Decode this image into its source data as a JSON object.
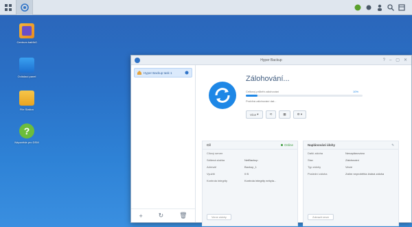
{
  "taskbar": {
    "left_buttons": [
      "main-menu",
      "hyper-backup"
    ],
    "right_icons": [
      "synology-drive-icon",
      "notification-icon",
      "user-icon",
      "search-icon",
      "widget-icon"
    ]
  },
  "desktop": {
    "icons": [
      {
        "name": "package-center-icon",
        "label": "Centrum balíčků"
      },
      {
        "name": "control-panel-icon",
        "label": "Ovládací panel"
      },
      {
        "name": "file-station-icon",
        "label": "File Station"
      },
      {
        "name": "help-icon",
        "label": "Nápověda pro DSM"
      }
    ]
  },
  "window": {
    "title": "Hyper Backup",
    "sidebar": {
      "task_label": "Hyper Backup task 1"
    },
    "status": {
      "title": "Zálohování...",
      "progress_label": "Celkový průběh zálohování",
      "progress_percent": "10%",
      "progress_fraction": 0.1,
      "detail": "Probíhá zálohování dat..."
    },
    "actions": {
      "more_label": "Více"
    },
    "panel_left": {
      "heading": "Cíl",
      "status": "Online",
      "rows": [
        {
          "k": "Cílový server",
          "v": ""
        },
        {
          "k": "Sdílená složka",
          "v": "NetBackup"
        },
        {
          "k": "Adresář",
          "v": "Backup_1"
        },
        {
          "k": "Využití",
          "v": "0 B"
        },
        {
          "k": "Kontrola integrity",
          "v": "Kontrola integrity nebyla..."
        }
      ],
      "button": "Verze zálohy"
    },
    "panel_right": {
      "heading": "Naplánování úlohy",
      "rows": [
        {
          "k": "Další záloha",
          "v": "Nenaplánováno"
        },
        {
          "k": "Stav",
          "v": "Zálohování"
        },
        {
          "k": "Typ zálohy",
          "v": "Verze"
        },
        {
          "k": "Poslední záloha",
          "v": "Zatím neproběhla žádná záloha"
        }
      ],
      "button": "Zobrazit verze"
    }
  }
}
